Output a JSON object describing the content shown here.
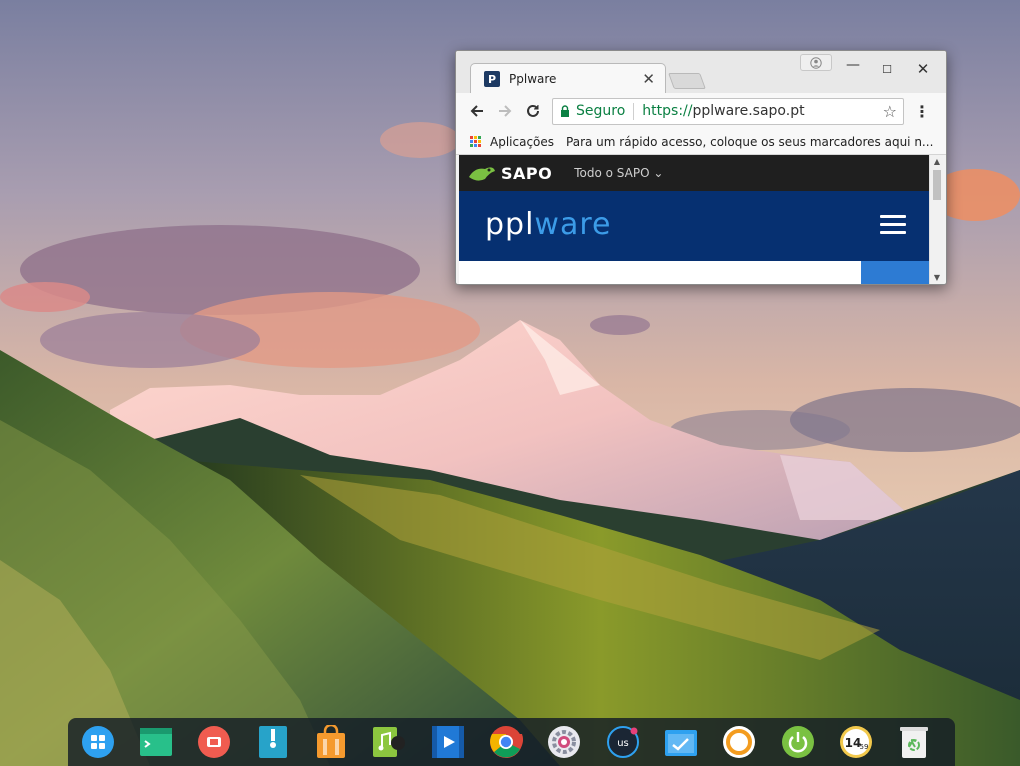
{
  "browser": {
    "tab": {
      "favicon": "P",
      "title": "Pplware"
    },
    "toolbar": {
      "secure_label": "Seguro",
      "url_scheme": "https://",
      "url_host": "pplware.sapo.pt"
    },
    "bookmarks": {
      "apps_label": "Aplicações",
      "hint": "Para um rápido acesso, coloque os seus marcadores aqui n..."
    },
    "page": {
      "sapo_logo": "SAPO",
      "sapo_menu": "Todo o SAPO ⌄",
      "site_logo_a": "ppl",
      "site_logo_b": "ware"
    }
  },
  "dock": {
    "items": [
      "launcher-icon",
      "terminal-icon",
      "screen-recorder-icon",
      "archive-icon",
      "app-store-icon",
      "music-player-icon",
      "movie-player-icon",
      "chrome-icon",
      "settings-icon",
      "network-monitor-icon",
      "system-monitor-icon",
      "backup-icon",
      "power-icon",
      "clock-icon",
      "trash-icon"
    ],
    "clock": {
      "hours": "14",
      "minutes": "59"
    }
  },
  "colors": {
    "site_header": "#063071",
    "sapo_bar": "#1f1f1f",
    "secure_green": "#0b8043",
    "site_accent": "#3c9ce8"
  }
}
